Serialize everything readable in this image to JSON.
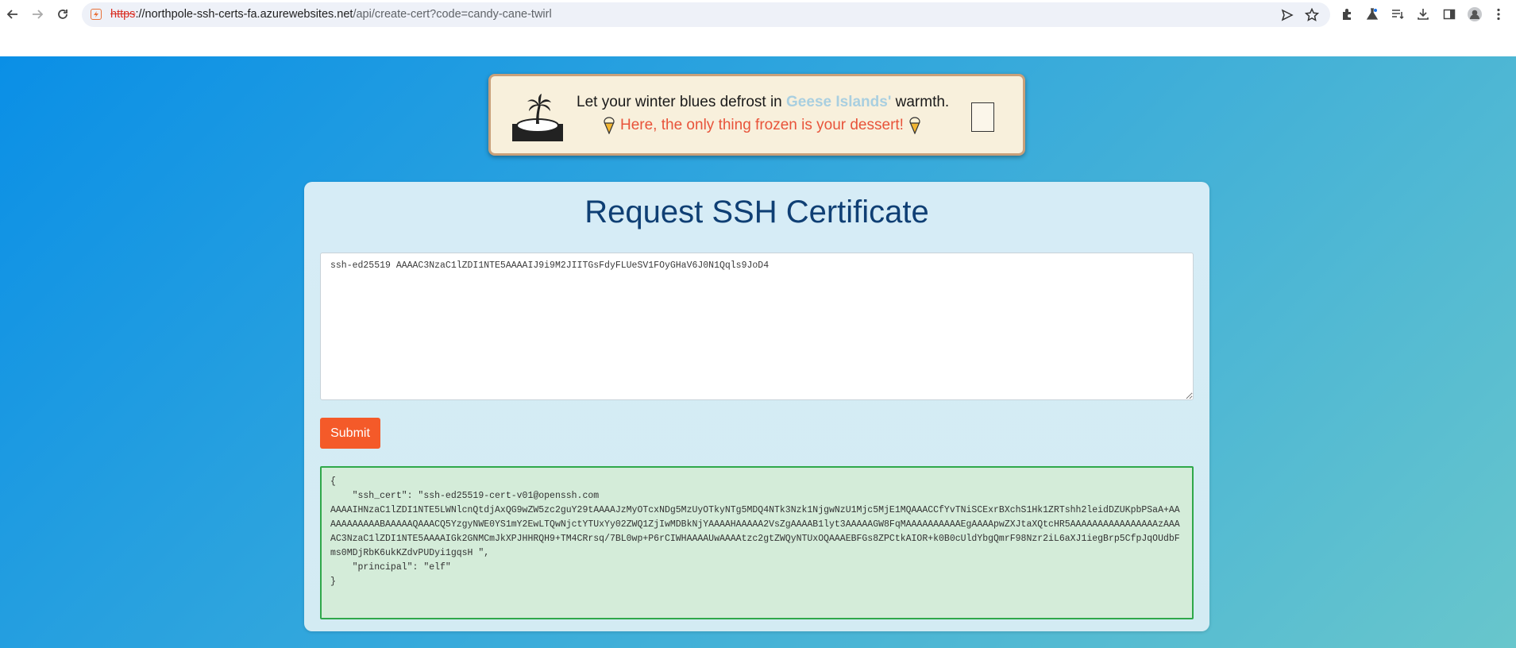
{
  "browser": {
    "url_scheme": "https",
    "url_domain": "://northpole-ssh-certs-fa.azurewebsites.net",
    "url_path": "/api/create-cert?code=candy-cane-twirl"
  },
  "banner": {
    "text_before": "Let your winter blues defrost in ",
    "highlight": "Geese Islands'",
    "text_after": " warmth.",
    "line2": "Here, the only thing frozen is your dessert!"
  },
  "card": {
    "title": "Request SSH Certificate",
    "public_key_value": "ssh-ed25519 AAAAC3NzaC1lZDI1NTE5AAAAIJ9i9M2JIITGsFdyFLUeSV1FOyGHaV6J0N1Qqls9JoD4",
    "submit_label": "Submit"
  },
  "result": {
    "open_brace": "{",
    "ssh_cert_key": "    \"ssh_cert\": \"ssh-ed25519-cert-v01@openssh.com",
    "ssh_cert_body": "AAAAIHNzaC1lZDI1NTE5LWNlcnQtdjAxQG9wZW5zc2guY29tAAAAJzMyOTcxNDg5MzUyOTkyNTg5MDQ4NTk3Nzk1NjgwNzU1Mjc5MjE1MQAAACCfYvTNiSCExrBXchS1Hk1ZRTshh2leidDZUKpbPSaA+AAAAAAAAAAABAAAAAQAAACQ5YzgyNWE0YS1mY2EwLTQwNjctYTUxYy02ZWQ1ZjIwMDBkNjYAAAAHAAAAA2VsZgAAAAB1lyt3AAAAAGW8FqMAAAAAAAAAAEgAAAApwZXJtaXQtcHR5AAAAAAAAAAAAAAAAzAAAAC3NzaC1lZDI1NTE5AAAAIGk2GNMCmJkXPJHHRQH9+TM4CRrsq/7BL0wp+P6rCIWHAAAAUwAAAAtzc2gtZWQyNTUxOQAAAEBFGs8ZPCtkAIOR+k0B0cUldYbgQmrF98Nzr2iL6aXJ1iegBrp5CfpJqOUdbFms0MDjRbK6ukKZdvPUDyi1gqsH \",",
    "principal_line": "    \"principal\": \"elf\"",
    "close_brace": "}"
  }
}
